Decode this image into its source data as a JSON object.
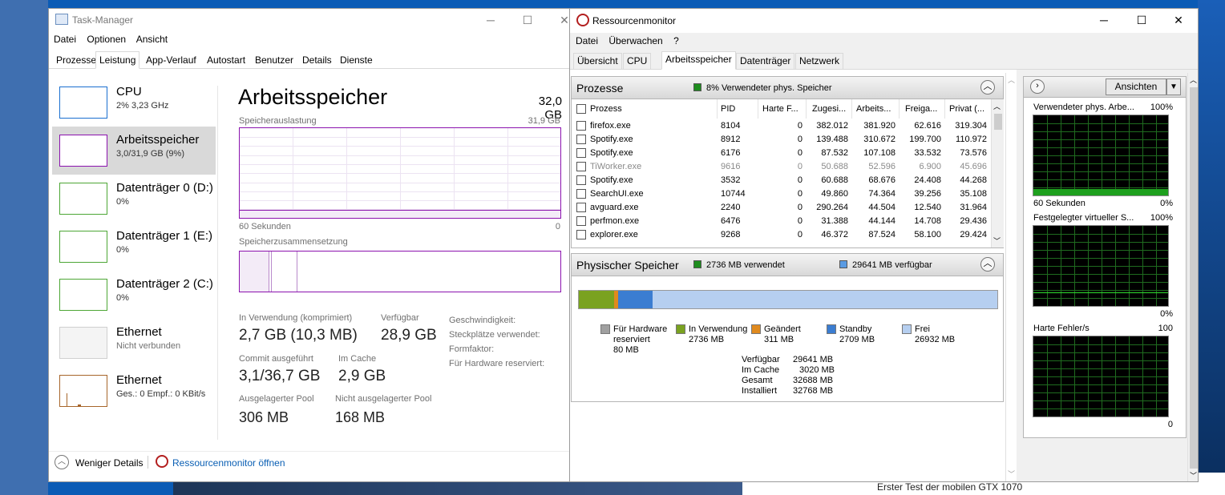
{
  "background": {
    "site_text": "Erster Test der mobilen GTX 1070"
  },
  "taskmanager": {
    "title": "Task-Manager",
    "menu": [
      "Datei",
      "Optionen",
      "Ansicht"
    ],
    "tabs": [
      "Prozesse",
      "Leistung",
      "App-Verlauf",
      "Autostart",
      "Benutzer",
      "Details",
      "Dienste"
    ],
    "active_tab": "Leistung",
    "sidebar": [
      {
        "name": "CPU",
        "sub": "2% 3,23 GHz",
        "color": "#1a6fd0"
      },
      {
        "name": "Arbeitsspeicher",
        "sub": "3,0/31,9 GB (9%)",
        "color": "#8b12ae"
      },
      {
        "name": "Datenträger 0 (D:)",
        "sub": "0%",
        "color": "#4da635"
      },
      {
        "name": "Datenträger 1 (E:)",
        "sub": "0%",
        "color": "#4da635"
      },
      {
        "name": "Datenträger 2 (C:)",
        "sub": "0%",
        "color": "#4da635"
      },
      {
        "name": "Ethernet",
        "sub": "Nicht verbunden",
        "color": "#cfcfcf"
      },
      {
        "name": "Ethernet",
        "sub": "Ges.: 0 Empf.: 0 KBit/s",
        "color": "#a7652a"
      }
    ],
    "main": {
      "title": "Arbeitsspeicher",
      "total": "32,0 GB",
      "usage_label": "Speicherauslastung",
      "usage_max": "31,9 GB",
      "time_left": "60 Sekunden",
      "time_right": "0",
      "composition_label": "Speicherzusammensetzung",
      "stats": [
        {
          "label": "In Verwendung (komprimiert)",
          "value": "2,7 GB (10,3 MB)"
        },
        {
          "label": "Verfügbar",
          "value": "28,9 GB"
        },
        {
          "label": "Commit ausgeführt",
          "value": "3,1/36,7 GB"
        },
        {
          "label": "Im Cache",
          "value": "2,9 GB"
        },
        {
          "label": "Ausgelagerter Pool",
          "value": "306 MB"
        },
        {
          "label": "Nicht ausgelagerter Pool",
          "value": "168 MB"
        }
      ],
      "right_labels": [
        "Geschwindigkeit:",
        "Steckplätze verwendet:",
        "Formfaktor:",
        "Für Hardware reserviert:"
      ]
    },
    "footer": {
      "less": "Weniger Details",
      "open_rm": "Ressourcenmonitor öffnen"
    }
  },
  "resmon": {
    "title": "Ressourcenmonitor",
    "menu": [
      "Datei",
      "Überwachen",
      "?"
    ],
    "tabs": [
      "Übersicht",
      "CPU",
      "Arbeitsspeicher",
      "Datenträger",
      "Netzwerk"
    ],
    "processes": {
      "title": "Prozesse",
      "status": "8% Verwendeter phys. Speicher",
      "columns": [
        "Prozess",
        "PID",
        "Harte F...",
        "Zugesi...",
        "Arbeits...",
        "Freiga...",
        "Privat (..."
      ],
      "rows": [
        [
          "firefox.exe",
          "8104",
          "0",
          "382.012",
          "381.920",
          "62.616",
          "319.304"
        ],
        [
          "Spotify.exe",
          "8912",
          "0",
          "139.488",
          "310.672",
          "199.700",
          "110.972"
        ],
        [
          "Spotify.exe",
          "6176",
          "0",
          "87.532",
          "107.108",
          "33.532",
          "73.576"
        ],
        [
          "TiWorker.exe",
          "9616",
          "0",
          "50.688",
          "52.596",
          "6.900",
          "45.696"
        ],
        [
          "Spotify.exe",
          "3532",
          "0",
          "60.688",
          "68.676",
          "24.408",
          "44.268"
        ],
        [
          "SearchUI.exe",
          "10744",
          "0",
          "49.860",
          "74.364",
          "39.256",
          "35.108"
        ],
        [
          "avguard.exe",
          "2240",
          "0",
          "290.264",
          "44.504",
          "12.540",
          "31.964"
        ],
        [
          "perfmon.exe",
          "6476",
          "0",
          "31.388",
          "44.144",
          "14.708",
          "29.436"
        ],
        [
          "explorer.exe",
          "9268",
          "0",
          "46.372",
          "87.524",
          "58.100",
          "29.424"
        ]
      ]
    },
    "physical": {
      "title": "Physischer Speicher",
      "used": "2736 MB verwendet",
      "available": "29641 MB verfügbar",
      "legend": [
        {
          "label": "Für Hardware reserviert",
          "value": "80 MB",
          "color": "#a0a0a0"
        },
        {
          "label": "In Verwendung",
          "value": "2736 MB",
          "color": "#7aa220"
        },
        {
          "label": "Geändert",
          "value": "311 MB",
          "color": "#e08a1e"
        },
        {
          "label": "Standby",
          "value": "2709 MB",
          "color": "#3b7dd1"
        },
        {
          "label": "Frei",
          "value": "26932 MB",
          "color": "#b6cff0"
        }
      ],
      "summary": [
        {
          "k": "Verfügbar",
          "v": "29641 MB"
        },
        {
          "k": "Im Cache",
          "v": "3020 MB"
        },
        {
          "k": "Gesamt",
          "v": "32688 MB"
        },
        {
          "k": "Installiert",
          "v": "32768 MB"
        }
      ]
    },
    "side": {
      "view_btn": "Ansichten",
      "graphs": [
        {
          "title": "Verwendeter phys. Arbe...",
          "max": "100%",
          "bl": "60 Sekunden",
          "br": "0%"
        },
        {
          "title": "Festgelegter virtueller S...",
          "max": "100%",
          "bl": "",
          "br": "0%"
        },
        {
          "title": "Harte Fehler/s",
          "max": "100",
          "bl": "",
          "br": "0"
        }
      ]
    }
  }
}
